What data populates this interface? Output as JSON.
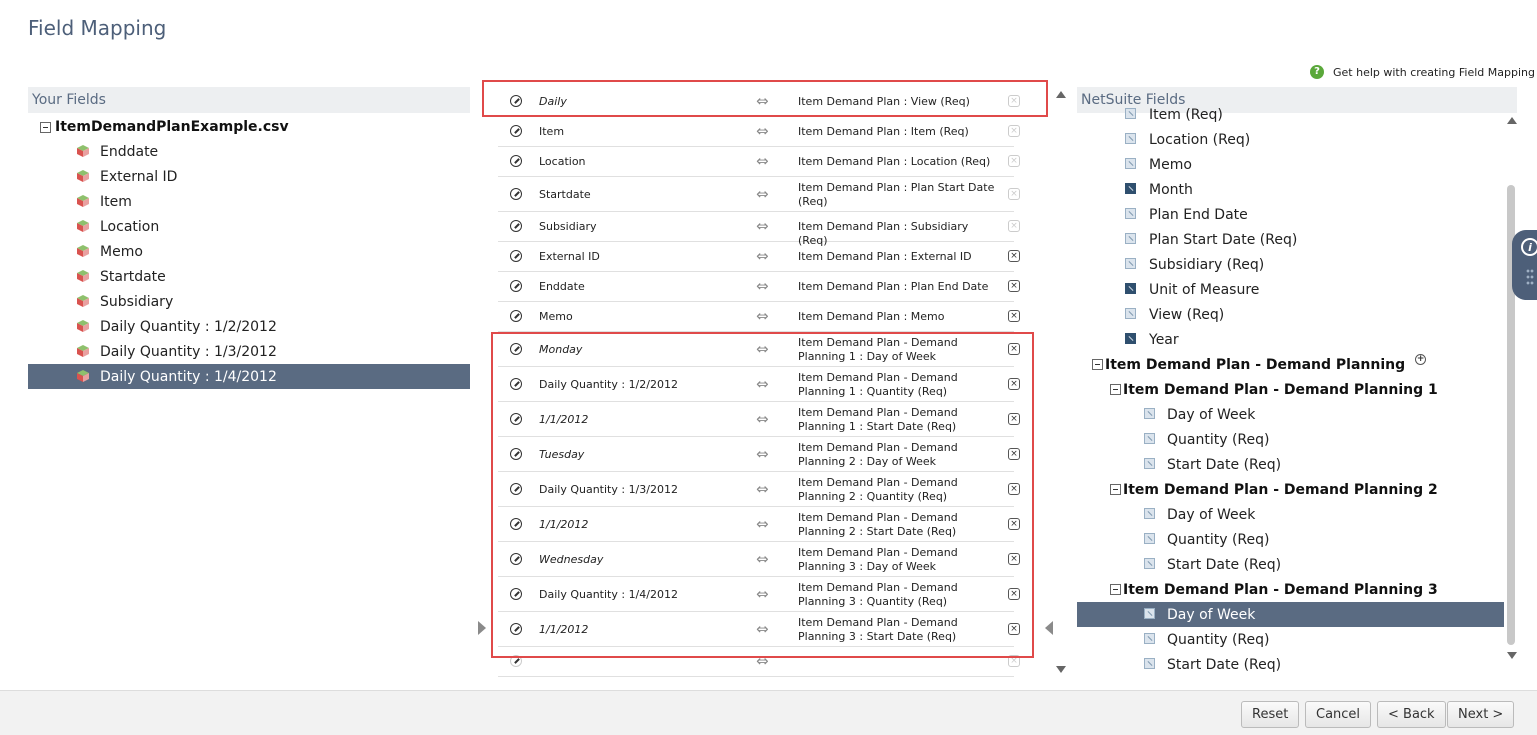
{
  "page_title": "Field Mapping",
  "help": {
    "icon": "question-circle-icon",
    "label": "Get help with creating Field Mapping"
  },
  "your_fields": {
    "header": "Your Fields",
    "file_name": "ItemDemandPlanExample.csv",
    "items": [
      {
        "label": "Enddate"
      },
      {
        "label": "External ID"
      },
      {
        "label": "Item"
      },
      {
        "label": "Location"
      },
      {
        "label": "Memo"
      },
      {
        "label": "Startdate"
      },
      {
        "label": "Subsidiary"
      },
      {
        "label": "Daily Quantity : 1/2/2012"
      },
      {
        "label": "Daily Quantity : 1/3/2012"
      },
      {
        "label": "Daily Quantity : 1/4/2012",
        "selected": true
      }
    ]
  },
  "mappings": [
    {
      "source": "Daily",
      "italic": true,
      "target": "Item Demand Plan : View (Req)",
      "deletable": false
    },
    {
      "source": "Item",
      "italic": false,
      "target": "Item Demand Plan : Item (Req)",
      "deletable": false
    },
    {
      "source": "Location",
      "italic": false,
      "target": "Item Demand Plan : Location (Req)",
      "deletable": false
    },
    {
      "source": "Startdate",
      "italic": false,
      "target": "Item Demand Plan : Plan Start Date (Req)",
      "deletable": false
    },
    {
      "source": "Subsidiary",
      "italic": false,
      "target": "Item Demand Plan : Subsidiary (Req)",
      "deletable": false
    },
    {
      "source": "External ID",
      "italic": false,
      "target": "Item Demand Plan : External ID",
      "deletable": true
    },
    {
      "source": "Enddate",
      "italic": false,
      "target": "Item Demand Plan : Plan End Date",
      "deletable": true
    },
    {
      "source": "Memo",
      "italic": false,
      "target": "Item Demand Plan : Memo",
      "deletable": true
    },
    {
      "source": "Monday",
      "italic": true,
      "target": "Item Demand Plan - Demand Planning 1 : Day of Week",
      "deletable": true
    },
    {
      "source": "Daily Quantity : 1/2/2012",
      "italic": false,
      "target": "Item Demand Plan - Demand Planning 1 : Quantity (Req)",
      "deletable": true
    },
    {
      "source": "1/1/2012",
      "italic": true,
      "target": "Item Demand Plan - Demand Planning 1 : Start Date (Req)",
      "deletable": true
    },
    {
      "source": "Tuesday",
      "italic": true,
      "target": "Item Demand Plan - Demand Planning 2 : Day of Week",
      "deletable": true
    },
    {
      "source": "Daily Quantity : 1/3/2012",
      "italic": false,
      "target": "Item Demand Plan - Demand Planning 2 : Quantity (Req)",
      "deletable": true
    },
    {
      "source": "1/1/2012",
      "italic": true,
      "target": "Item Demand Plan - Demand Planning 2 : Start Date (Req)",
      "deletable": true
    },
    {
      "source": "Wednesday",
      "italic": true,
      "target": "Item Demand Plan - Demand Planning 3 : Day of Week",
      "deletable": true
    },
    {
      "source": "Daily Quantity : 1/4/2012",
      "italic": false,
      "target": "Item Demand Plan - Demand Planning 3 : Quantity (Req)",
      "deletable": true
    },
    {
      "source": "1/1/2012",
      "italic": true,
      "target": "Item Demand Plan - Demand Planning 3 : Start Date (Req)",
      "deletable": true
    },
    {
      "source": "",
      "italic": false,
      "target": "",
      "deletable": false
    }
  ],
  "netsuite_fields": {
    "header": "NetSuite Fields",
    "items": [
      {
        "label": "Item (Req)",
        "kind": "field",
        "level": 0
      },
      {
        "label": "Location (Req)",
        "kind": "field",
        "level": 0
      },
      {
        "label": "Memo",
        "kind": "field",
        "level": 0
      },
      {
        "label": "Month",
        "kind": "field-dark",
        "level": 0
      },
      {
        "label": "Plan End Date",
        "kind": "field",
        "level": 0
      },
      {
        "label": "Plan Start Date (Req)",
        "kind": "field",
        "level": 0
      },
      {
        "label": "Subsidiary (Req)",
        "kind": "field",
        "level": 0
      },
      {
        "label": "Unit of Measure",
        "kind": "field-dark",
        "level": 0
      },
      {
        "label": "View (Req)",
        "kind": "field",
        "level": 0
      },
      {
        "label": "Year",
        "kind": "field-dark",
        "level": 0
      },
      {
        "label": "Item Demand Plan - Demand Planning",
        "kind": "group-plus",
        "level": 0
      },
      {
        "label": "Item Demand Plan - Demand Planning 1",
        "kind": "group",
        "level": 1
      },
      {
        "label": "Day of Week",
        "kind": "field",
        "level": 2
      },
      {
        "label": "Quantity (Req)",
        "kind": "field",
        "level": 2
      },
      {
        "label": "Start Date (Req)",
        "kind": "field",
        "level": 2
      },
      {
        "label": "Item Demand Plan - Demand Planning 2",
        "kind": "group",
        "level": 1
      },
      {
        "label": "Day of Week",
        "kind": "field",
        "level": 2
      },
      {
        "label": "Quantity (Req)",
        "kind": "field",
        "level": 2
      },
      {
        "label": "Start Date (Req)",
        "kind": "field",
        "level": 2
      },
      {
        "label": "Item Demand Plan - Demand Planning 3",
        "kind": "group",
        "level": 1
      },
      {
        "label": "Day of Week",
        "kind": "field",
        "level": 2,
        "selected": true
      },
      {
        "label": "Quantity (Req)",
        "kind": "field",
        "level": 2
      },
      {
        "label": "Start Date (Req)",
        "kind": "field",
        "level": 2
      }
    ]
  },
  "buttons": {
    "reset": "Reset",
    "cancel": "Cancel",
    "back": "< Back",
    "next": "Next >"
  },
  "info_tab": {
    "icon": "info-icon"
  },
  "colors": {
    "title": "#4d5f79",
    "selected_row": "#5a6b82",
    "highlight_border": "#e04a4a",
    "help_icon": "#5aa83a"
  }
}
